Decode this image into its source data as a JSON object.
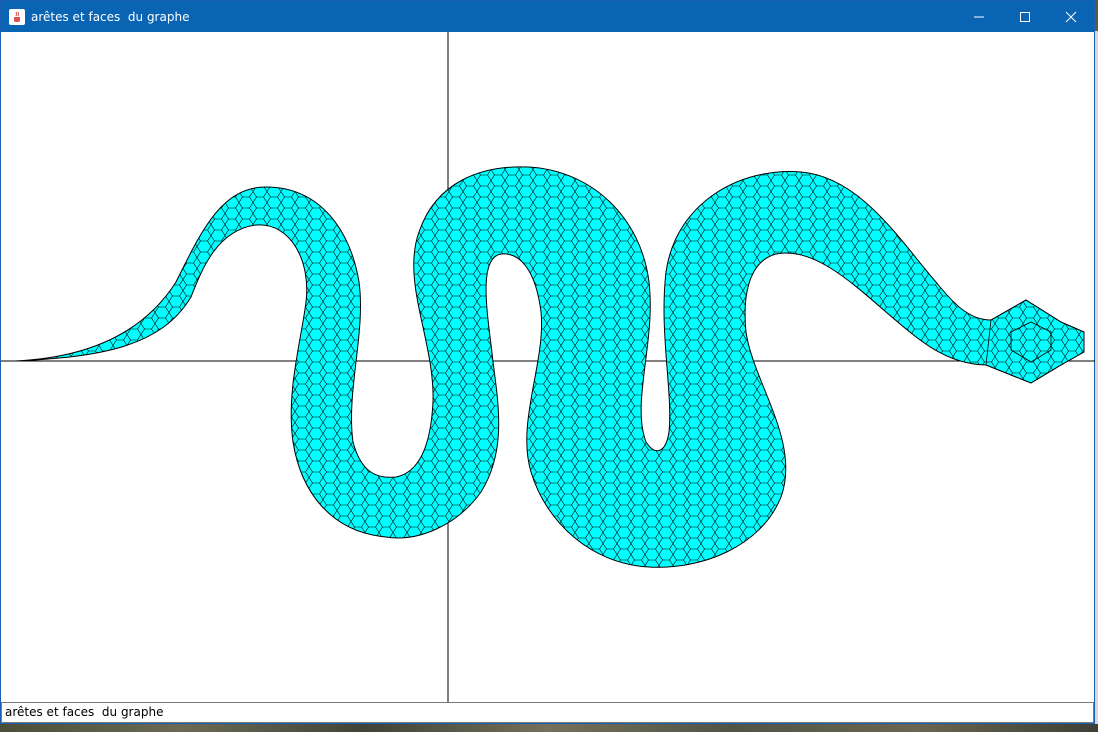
{
  "window": {
    "title": "arêtes et faces  du graphe",
    "app_icon": "java-cup-icon",
    "controls": [
      "minimize-icon",
      "maximize-icon",
      "close-icon"
    ]
  },
  "canvas": {
    "shape_fill": "#00ffff",
    "edge_color": "#000000",
    "axes_color": "#000000"
  },
  "status": {
    "text": "arêtes et faces  du graphe"
  },
  "colors": {
    "titlebar": "#0a64b4",
    "background": "#ffffff"
  }
}
